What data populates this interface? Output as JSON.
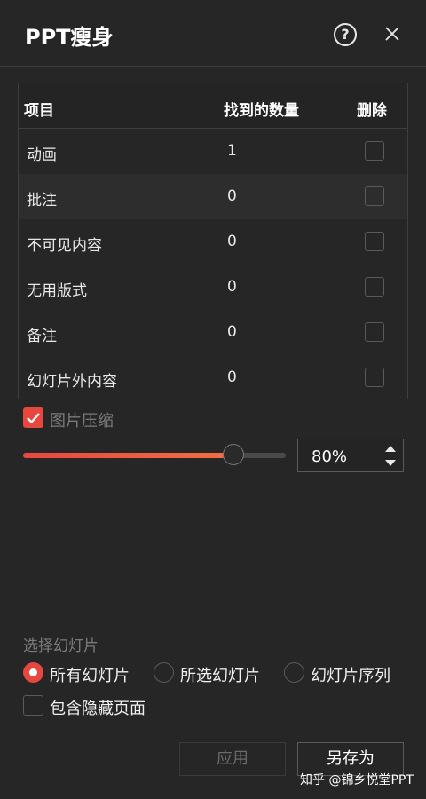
{
  "window": {
    "title": "PPT瘦身",
    "help_symbol": "?"
  },
  "table": {
    "headers": {
      "item": "项目",
      "count": "找到的数量",
      "delete": "删除"
    },
    "rows": [
      {
        "name": "动画",
        "count": "1"
      },
      {
        "name": "批注",
        "count": "0"
      },
      {
        "name": "不可见内容",
        "count": "0"
      },
      {
        "name": "无用版式",
        "count": "0"
      },
      {
        "name": "备注",
        "count": "0"
      },
      {
        "name": "幻灯片外内容",
        "count": "0"
      }
    ]
  },
  "compress": {
    "label": "图片压缩",
    "checked": true,
    "value": "80%",
    "slider_percent": 80
  },
  "selection": {
    "label": "选择幻灯片",
    "options": [
      {
        "label": "所有幻灯片",
        "selected": true
      },
      {
        "label": "所选幻灯片",
        "selected": false
      },
      {
        "label": "幻灯片序列",
        "selected": false
      }
    ],
    "include_hidden": "包含隐藏页面"
  },
  "buttons": {
    "apply": "应用",
    "save_as": "另存为"
  },
  "watermark": "知乎 @锦乡悦堂PPT",
  "colors": {
    "accent": "#e8473f",
    "background": "#262626"
  }
}
